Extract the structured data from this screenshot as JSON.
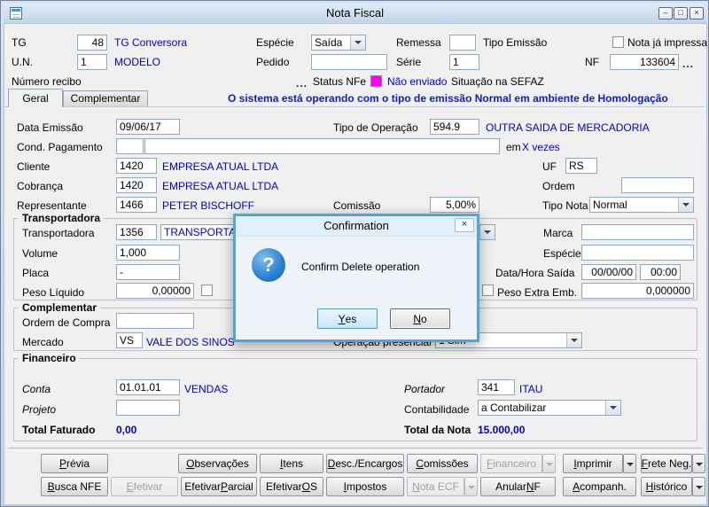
{
  "colors": {
    "accent_blue": "#0000CC",
    "banner_blue": "#0B20CC",
    "status_magenta": "#FF00FF",
    "dialog_border": "#4DA7D8"
  },
  "window": {
    "title": "Nota Fiscal",
    "minimize": "–",
    "maximize": "□",
    "close": "×"
  },
  "header": {
    "tg_label": "TG",
    "tg_value": "48",
    "tg_desc": "TG Conversora",
    "especie_label": "Espécie",
    "especie_value": "Saída",
    "remessa_label": "Remessa",
    "remessa_value": "",
    "tipo_emissao_label": "Tipo Emissão",
    "nota_impressa_label": "Nota já impressa",
    "un_label": "U.N.",
    "un_value": "1",
    "un_desc": "MODELO",
    "pedido_label": "Pedido",
    "pedido_value": "",
    "serie_label": "Série",
    "serie_value": "1",
    "nf_label": "NF",
    "nf_value": "133604",
    "nf_browse": "...",
    "numero_recibo_label": "Número recibo",
    "recibo_browse": "...",
    "status_nfe_label": "Status NFe",
    "status_nfe_value": "Não enviado",
    "situacao_sefaz_label": "Situação na SEFAZ"
  },
  "tabs": {
    "geral": "Geral",
    "complementar": "Complementar",
    "banner": "O sistema está operando com o tipo de emissão Normal em ambiente de Homologação"
  },
  "geral": {
    "data_emissao_label": "Data Emissão",
    "data_emissao_value": "09/06/17",
    "tipo_operacao_label": "Tipo de Operação",
    "tipo_operacao_value": "594.9",
    "tipo_operacao_desc": "OUTRA SAIDA DE MERCADORIA",
    "cond_pagamento_label": "Cond. Pagamento",
    "cond_pagamento_code": "",
    "cond_pagamento_desc": "",
    "em_label": "em",
    "vezes_text": "X vezes",
    "cliente_label": "Cliente",
    "cliente_code": "1420",
    "cliente_desc": "EMPRESA ATUAL LTDA",
    "uf_label": "UF",
    "uf_value": "RS",
    "cobranca_label": "Cobrança",
    "cobranca_code": "1420",
    "cobranca_desc": "EMPRESA ATUAL LTDA",
    "ordem_label": "Ordem",
    "ordem_value": "",
    "representante_label": "Representante",
    "representante_code": "1466",
    "representante_desc": "PETER BISCHOFF",
    "comissao_label": "Comissão",
    "comissao_value": "5,00%",
    "tipo_nota_label": "Tipo Nota",
    "tipo_nota_value": "Normal"
  },
  "transportadora": {
    "group_label": "Transportadora",
    "transportadora_label": "Transportadora",
    "code": "1356",
    "desc": "TRANSPORTADOR",
    "marca_label": "Marca",
    "marca_value": "",
    "volume_label": "Volume",
    "volume_value": "1,000",
    "especie_label": "Espécie",
    "especie_value": "",
    "placa_label": "Placa",
    "placa_value": "-",
    "data_hora_label": "Data/Hora Saída",
    "data_value": "00/00/00",
    "hora_value": "00:00",
    "peso_liquido_label": "Peso Líquido",
    "peso_liquido_value": "0,00000",
    "peso_extra_label": "Peso Extra Emb.",
    "peso_extra_value": "0,000000"
  },
  "complementar": {
    "group_label": "Complementar",
    "ordem_compra_label": "Ordem de Compra",
    "ordem_compra_value": "",
    "mercado_label": "Mercado",
    "mercado_code": "VS",
    "mercado_desc": "VALE DOS SINOS",
    "operacao_presencial_label": "Operação presencial",
    "operacao_presencial_value": "1 Sim"
  },
  "financeiro": {
    "group_label": "Financeiro",
    "conta_label": "Conta",
    "conta_code": "01.01.01",
    "conta_desc": "VENDAS",
    "portador_label": "Portador",
    "portador_code": "341",
    "portador_desc": "ITAU",
    "projeto_label": "Projeto",
    "projeto_value": "",
    "contabilidade_label": "Contabilidade",
    "contabilidade_value": "a Contabilizar",
    "total_faturado_label": "Total Faturado",
    "total_faturado_value": "0,00",
    "total_nota_label": "Total da Nota",
    "total_nota_value": "15.000,00"
  },
  "dialog": {
    "title": "Confirmation",
    "close": "×",
    "icon": "?",
    "message": "Confirm Delete operation",
    "yes_btn": {
      "label": "Yes",
      "key": "Y"
    },
    "no_btn": {
      "label": "No",
      "key": "N"
    }
  },
  "buttons": {
    "row1": [
      {
        "label": "Prévia",
        "key": "P"
      },
      {
        "label": "Observações",
        "key": "O"
      },
      {
        "label": "Itens",
        "key": "I"
      },
      {
        "label": "Desc./Encargos",
        "key": "D"
      },
      {
        "label": "Comissões",
        "key": "C"
      },
      {
        "label": "Financeiro",
        "key": "F",
        "disabled": true
      },
      {
        "label": "Imprimir",
        "key": "I"
      },
      {
        "label": "Frete Neg.",
        "key": "F"
      }
    ],
    "row2": [
      {
        "label": "Busca NFE",
        "key": "B"
      },
      {
        "label": "Efetivar",
        "key": "E",
        "disabled": true
      },
      {
        "label": "Efetivar Parcial",
        "key": "P"
      },
      {
        "label": "Efetivar OS",
        "key": "O"
      },
      {
        "label": "Impostos",
        "key": "I"
      },
      {
        "label": "Nota ECF",
        "key": "N",
        "disabled": true
      },
      {
        "label": "Anular NF",
        "key": "N"
      },
      {
        "label": "Acompanh.",
        "key": "A"
      },
      {
        "label": "Histórico",
        "key": "H"
      }
    ]
  }
}
